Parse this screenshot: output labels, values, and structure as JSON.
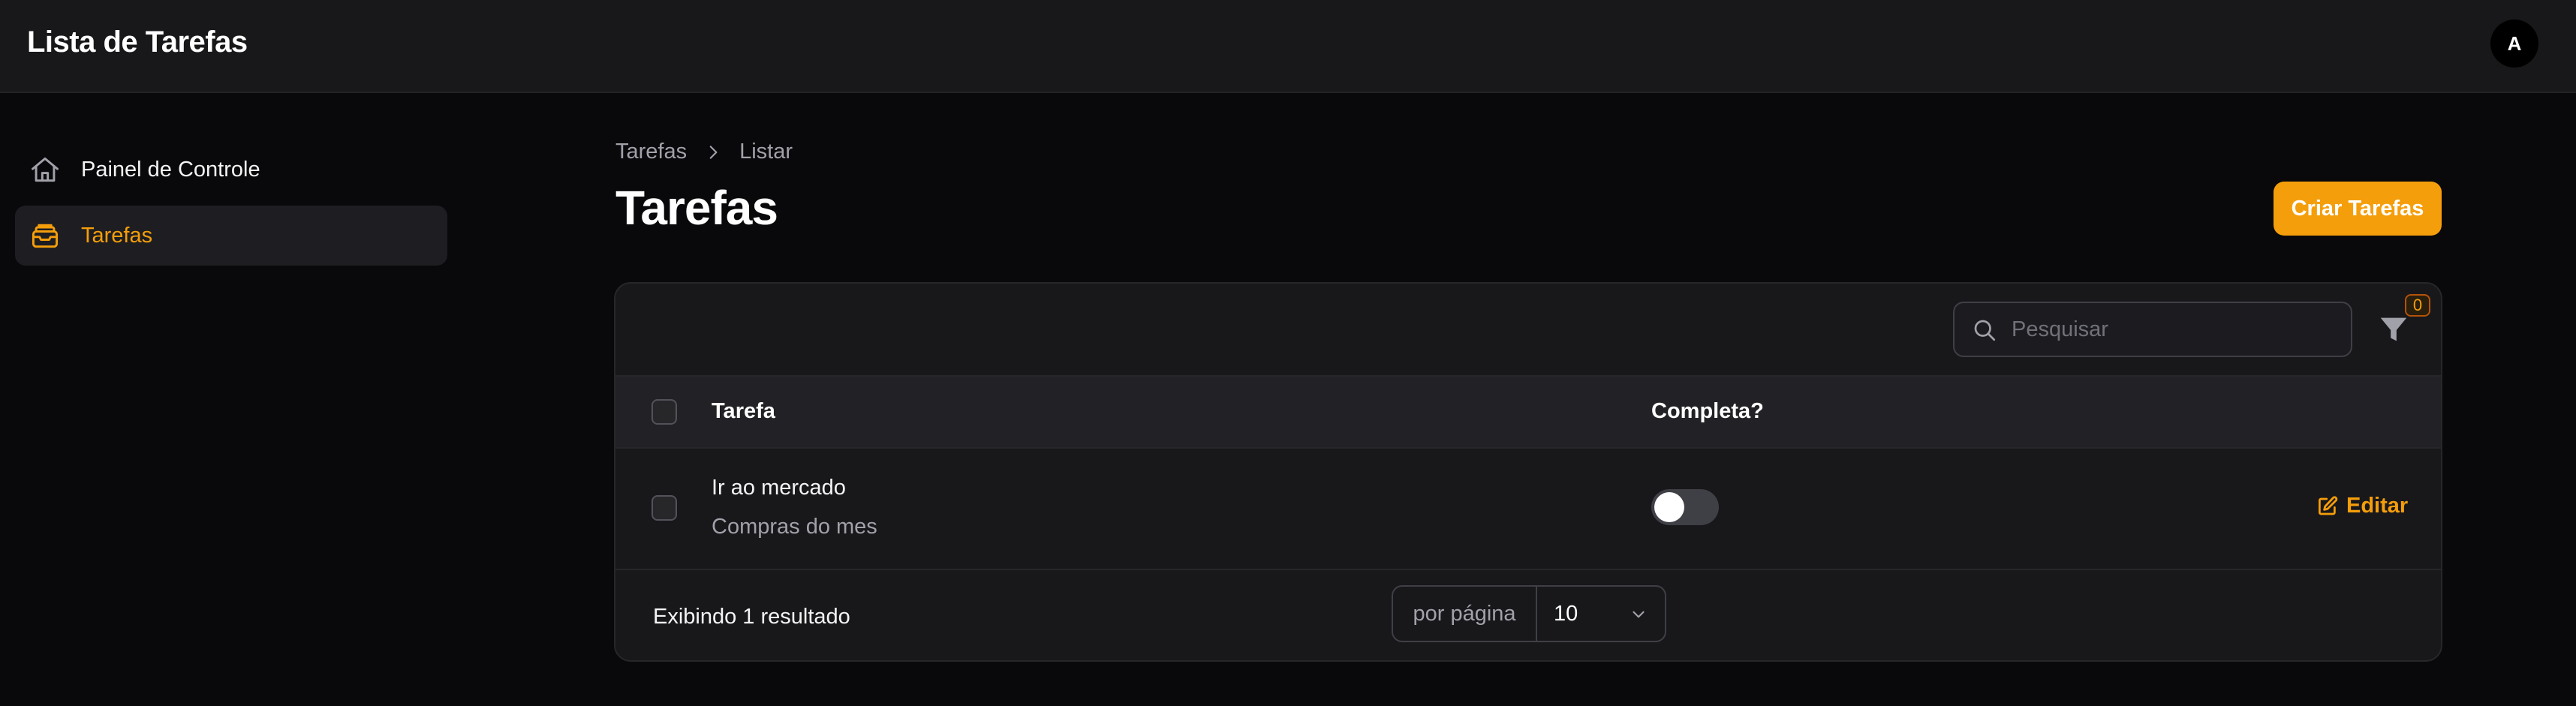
{
  "app": {
    "title": "Lista de Tarefas",
    "avatar_initial": "A"
  },
  "sidebar": {
    "items": [
      {
        "label": "Painel de Controle",
        "icon": "home-icon",
        "active": false
      },
      {
        "label": "Tarefas",
        "icon": "inbox-stack-icon",
        "active": true
      }
    ]
  },
  "breadcrumb": {
    "items": [
      "Tarefas",
      "Listar"
    ]
  },
  "page": {
    "title": "Tarefas",
    "create_label": "Criar Tarefas"
  },
  "toolbar": {
    "search_placeholder": "Pesquisar",
    "filter_count": "0"
  },
  "table": {
    "headers": {
      "task": "Tarefa",
      "complete": "Completa?"
    },
    "rows": [
      {
        "title": "Ir ao mercado",
        "description": "Compras do mes",
        "complete": false,
        "edit_label": "Editar"
      }
    ]
  },
  "footer": {
    "summary": "Exibindo 1 resultado",
    "per_page_label": "por página",
    "per_page_value": "10"
  },
  "colors": {
    "accent": "#f59e0b",
    "background": "#09090b",
    "surface": "#18181b"
  }
}
